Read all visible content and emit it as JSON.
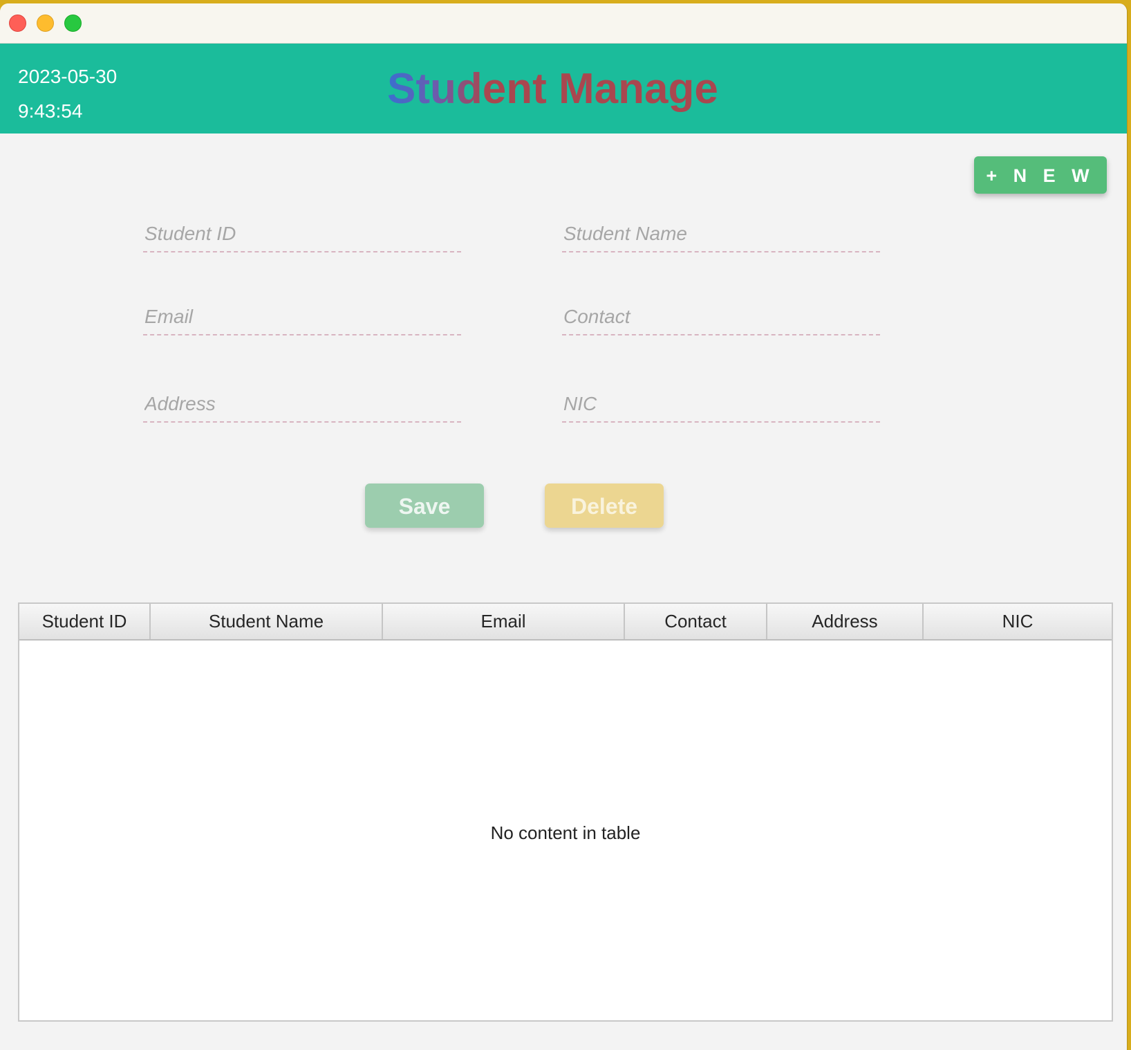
{
  "header": {
    "date": "2023-05-30",
    "time": "9:43:54",
    "title": "Student Manage"
  },
  "toolbar": {
    "new_label": "+ N E W"
  },
  "form": {
    "student_id_placeholder": "Student ID",
    "student_name_placeholder": "Student Name",
    "email_placeholder": "Email",
    "contact_placeholder": "Contact",
    "address_placeholder": "Address",
    "nic_placeholder": "NIC",
    "save_label": "Save",
    "delete_label": "Delete"
  },
  "table": {
    "columns": [
      "Student ID",
      "Student Name",
      "Email",
      "Contact",
      "Address",
      "NIC"
    ],
    "empty_message": "No content in table"
  },
  "colors": {
    "header_bg": "#1bbc9b",
    "new_button": "#55bd7a",
    "save_button": "#98cbab",
    "delete_button": "#ecd58c"
  }
}
